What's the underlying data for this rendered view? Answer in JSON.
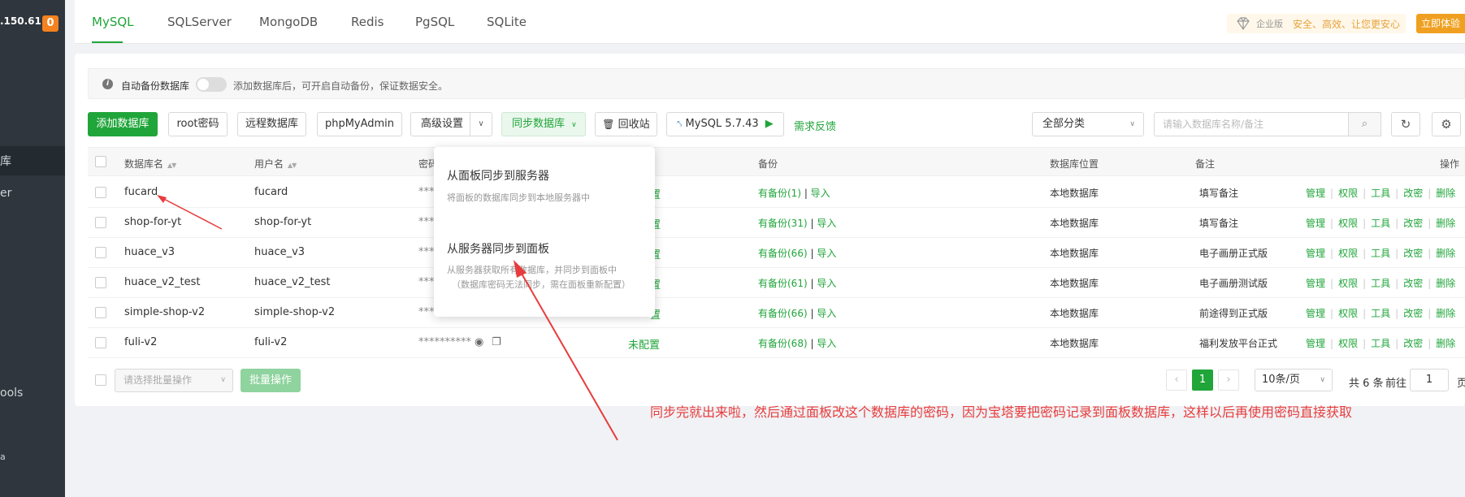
{
  "sidebar": {
    "ip": ".150.61",
    "badge": "0",
    "items": [
      "库",
      "er",
      "ools",
      "a"
    ]
  },
  "tabs": [
    "MySQL",
    "SQLServer",
    "MongoDB",
    "Redis",
    "PgSQL",
    "SQLite"
  ],
  "enterprise": {
    "version": "企业版",
    "slogan": "安全、高效、让您更安心",
    "trial": "立即体验"
  },
  "notice": {
    "label": "自动备份数据库",
    "hint": "添加数据库后，可开启自动备份，保证数据安全。"
  },
  "toolbar": {
    "add": "添加数据库",
    "root_pw": "root密码",
    "remote": "远程数据库",
    "phpmyadmin": "phpMyAdmin",
    "advanced": "高级设置",
    "sync": "同步数据库",
    "recycle": "回收站",
    "mysql_version": "MySQL 5.7.43",
    "feedback": "需求反馈",
    "category": "全部分类",
    "search_placeholder": "请输入数据库名称/备注"
  },
  "table": {
    "headers": {
      "name": "数据库名",
      "user": "用户名",
      "password": "密码",
      "backup": "备份",
      "location": "数据库位置",
      "note": "备注",
      "ops": "操作"
    },
    "rows": [
      {
        "name": "fucard",
        "user": "fucard",
        "pw": "***",
        "backup": "有备份(1)",
        "import": "导入",
        "location": "本地数据库",
        "note": "填写备注"
      },
      {
        "name": "shop-for-yt",
        "user": "shop-for-yt",
        "pw": "***",
        "backup": "有备份(31)",
        "import": "导入",
        "location": "本地数据库",
        "note": "填写备注"
      },
      {
        "name": "huace_v3",
        "user": "huace_v3",
        "pw": "***",
        "backup": "有备份(66)",
        "import": "导入",
        "location": "本地数据库",
        "note": "电子画册正式版"
      },
      {
        "name": "huace_v2_test",
        "user": "huace_v2_test",
        "pw": "***",
        "backup": "有备份(61)",
        "import": "导入",
        "location": "本地数据库",
        "note": "电子画册测试版"
      },
      {
        "name": "simple-shop-v2",
        "user": "simple-shop-v2",
        "pw": "***",
        "backup": "有备份(66)",
        "import": "导入",
        "location": "本地数据库",
        "note": "前途得到正式版"
      },
      {
        "name": "fuli-v2",
        "user": "fuli-v2",
        "pw": "**********",
        "ssl": "未配置",
        "backup": "有备份(68)",
        "import": "导入",
        "location": "本地数据库",
        "note": "福利发放平台正式"
      }
    ],
    "ops": [
      "管理",
      "权限",
      "工具",
      "改密",
      "删除"
    ],
    "ssl_partial": "置"
  },
  "dropdown": {
    "item1_title": "从面板同步到服务器",
    "item1_desc": "将面板的数据库同步到本地服务器中",
    "item2_title": "从服务器同步到面板",
    "item2_desc1": "从服务器获取所有数据库，并同步到面板中",
    "item2_desc2": "（数据库密码无法同步，需在面板重新配置）"
  },
  "bottom": {
    "batch_placeholder": "请选择批量操作",
    "batch_btn": "批量操作",
    "page_cur": "1",
    "page_size": "10条/页",
    "total": "共 6 条",
    "goto": "前往",
    "page_input": "1",
    "page_unit": "页"
  },
  "annotation": "同步完就出来啦，然后通过面板改这个数据库的密码，因为宝塔要把密码记录到面板数据库，这样以后再使用密码直接获取",
  "colors": {
    "accent": "#20a53a",
    "annotation": "#e83c3c",
    "sidebar": "#2f363d"
  }
}
